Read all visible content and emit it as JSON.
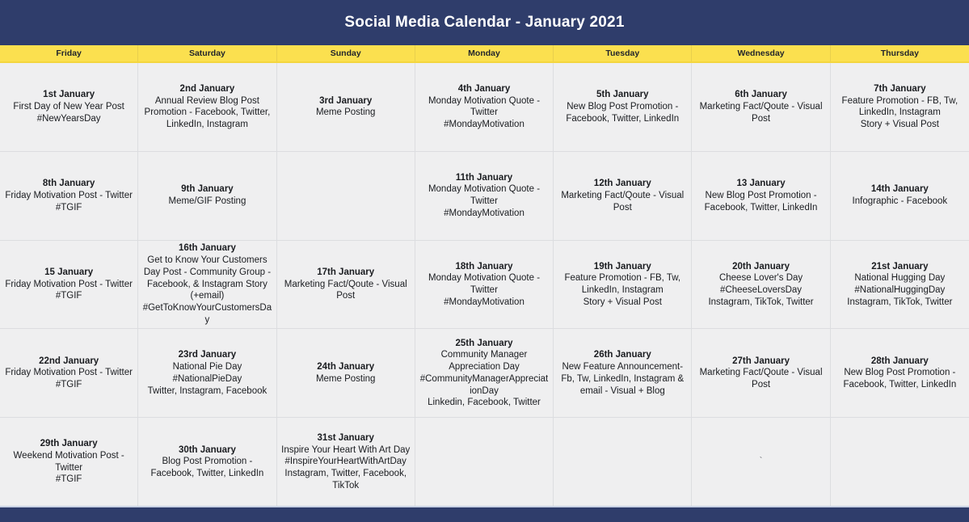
{
  "header": {
    "title": "Social Media Calendar - January 2021",
    "bg_color": "#2f3d6b",
    "text_color": "#ffffff"
  },
  "theme": {
    "navy": "#2f3d6b",
    "yellow": "#fbe04f",
    "cell_bg": "#efeff0",
    "grid_line": "#dcdde0"
  },
  "weekday_headers": [
    {
      "label": "Friday"
    },
    {
      "label": "Saturday"
    },
    {
      "label": "Sunday"
    },
    {
      "label": "Monday"
    },
    {
      "label": "Tuesday"
    },
    {
      "label": "Wednesday"
    },
    {
      "label": "Thursday"
    }
  ],
  "weeks": [
    {
      "cells": [
        {
          "date": "1st January",
          "desc": "First Day of New Year Post\n#NewYearsDay"
        },
        {
          "date": "2nd January",
          "desc": "Annual Review Blog Post Promotion - Facebook, Twitter, LinkedIn, Instagram"
        },
        {
          "date": "3rd January",
          "desc": "Meme Posting"
        },
        {
          "date": "4th January",
          "desc": "Monday Motivation Quote - Twitter\n#MondayMotivation"
        },
        {
          "date": "5th January",
          "desc": "New Blog Post Promotion - Facebook, Twitter, LinkedIn"
        },
        {
          "date": "6th January",
          "desc": "Marketing Fact/Qoute - Visual Post"
        },
        {
          "date": "7th January",
          "desc": "Feature Promotion - FB, Tw, LinkedIn, Instagram\nStory + Visual Post"
        }
      ]
    },
    {
      "cells": [
        {
          "date": "8th January",
          "desc": "Friday Motivation Post - Twitter\n#TGIF"
        },
        {
          "date": "9th January",
          "desc": "Meme/GIF Posting"
        },
        {
          "date": "",
          "desc": ""
        },
        {
          "date": "11th January",
          "desc": "Monday Motivation Quote - Twitter\n#MondayMotivation"
        },
        {
          "date": "12th January",
          "desc": "Marketing Fact/Qoute - Visual Post"
        },
        {
          "date": "13 January",
          "desc": "New Blog Post Promotion - Facebook, Twitter, LinkedIn"
        },
        {
          "date": "14th January",
          "desc": "Infographic - Facebook"
        }
      ]
    },
    {
      "cells": [
        {
          "date": "15 January",
          "desc": "Friday Motivation Post - Twitter\n#TGIF"
        },
        {
          "date": "16th January",
          "desc": "Get to Know Your Customers Day Post - Community Group - Facebook, & Instagram Story (+email)\n#GetToKnowYourCustomersDay"
        },
        {
          "date": "17th January",
          "desc": "Marketing Fact/Qoute - Visual Post"
        },
        {
          "date": "18th January",
          "desc": "Monday Motivation Quote - Twitter\n#MondayMotivation"
        },
        {
          "date": "19th January",
          "desc": "Feature Promotion - FB, Tw, LinkedIn, Instagram\nStory + Visual Post"
        },
        {
          "date": "20th January",
          "desc": "Cheese Lover's Day\n#CheeseLoversDay\nInstagram, TikTok, Twitter"
        },
        {
          "date": "21st January",
          "desc": "National Hugging Day\n#NationalHuggingDay\nInstagram, TikTok, Twitter"
        }
      ]
    },
    {
      "cells": [
        {
          "date": "22nd January",
          "desc": "Friday Motivation Post - Twitter\n#TGIF"
        },
        {
          "date": "23rd January",
          "desc": "National Pie Day\n#NationalPieDay\nTwitter, Instagram, Facebook"
        },
        {
          "date": "24th January",
          "desc": "Meme Posting"
        },
        {
          "date": "25th January",
          "desc": "Community Manager Appreciation Day\n#CommunityManagerAppreciationDay\nLinkedin, Facebook, Twitter"
        },
        {
          "date": "26th January",
          "desc": "New Feature Announcement- Fb, Tw, LinkedIn, Instagram & email - Visual + Blog"
        },
        {
          "date": "27th January",
          "desc": "Marketing Fact/Qoute - Visual Post"
        },
        {
          "date": "28th January",
          "desc": "New Blog Post Promotion - Facebook, Twitter, LinkedIn"
        }
      ]
    },
    {
      "cells": [
        {
          "date": "29th January",
          "desc": "Weekend Motivation Post - Twitter\n#TGIF"
        },
        {
          "date": "30th January",
          "desc": "Blog Post Promotion - Facebook, Twitter, LinkedIn"
        },
        {
          "date": "31st January",
          "desc": "Inspire Your Heart With Art Day\n#InspireYourHeartWithArtDay\nInstagram, Twitter, Facebook, TikTok"
        },
        {
          "date": "",
          "desc": ""
        },
        {
          "date": "",
          "desc": ""
        },
        {
          "date": "",
          "desc": "",
          "stray_mark": "`"
        },
        {
          "date": "",
          "desc": ""
        }
      ]
    }
  ]
}
